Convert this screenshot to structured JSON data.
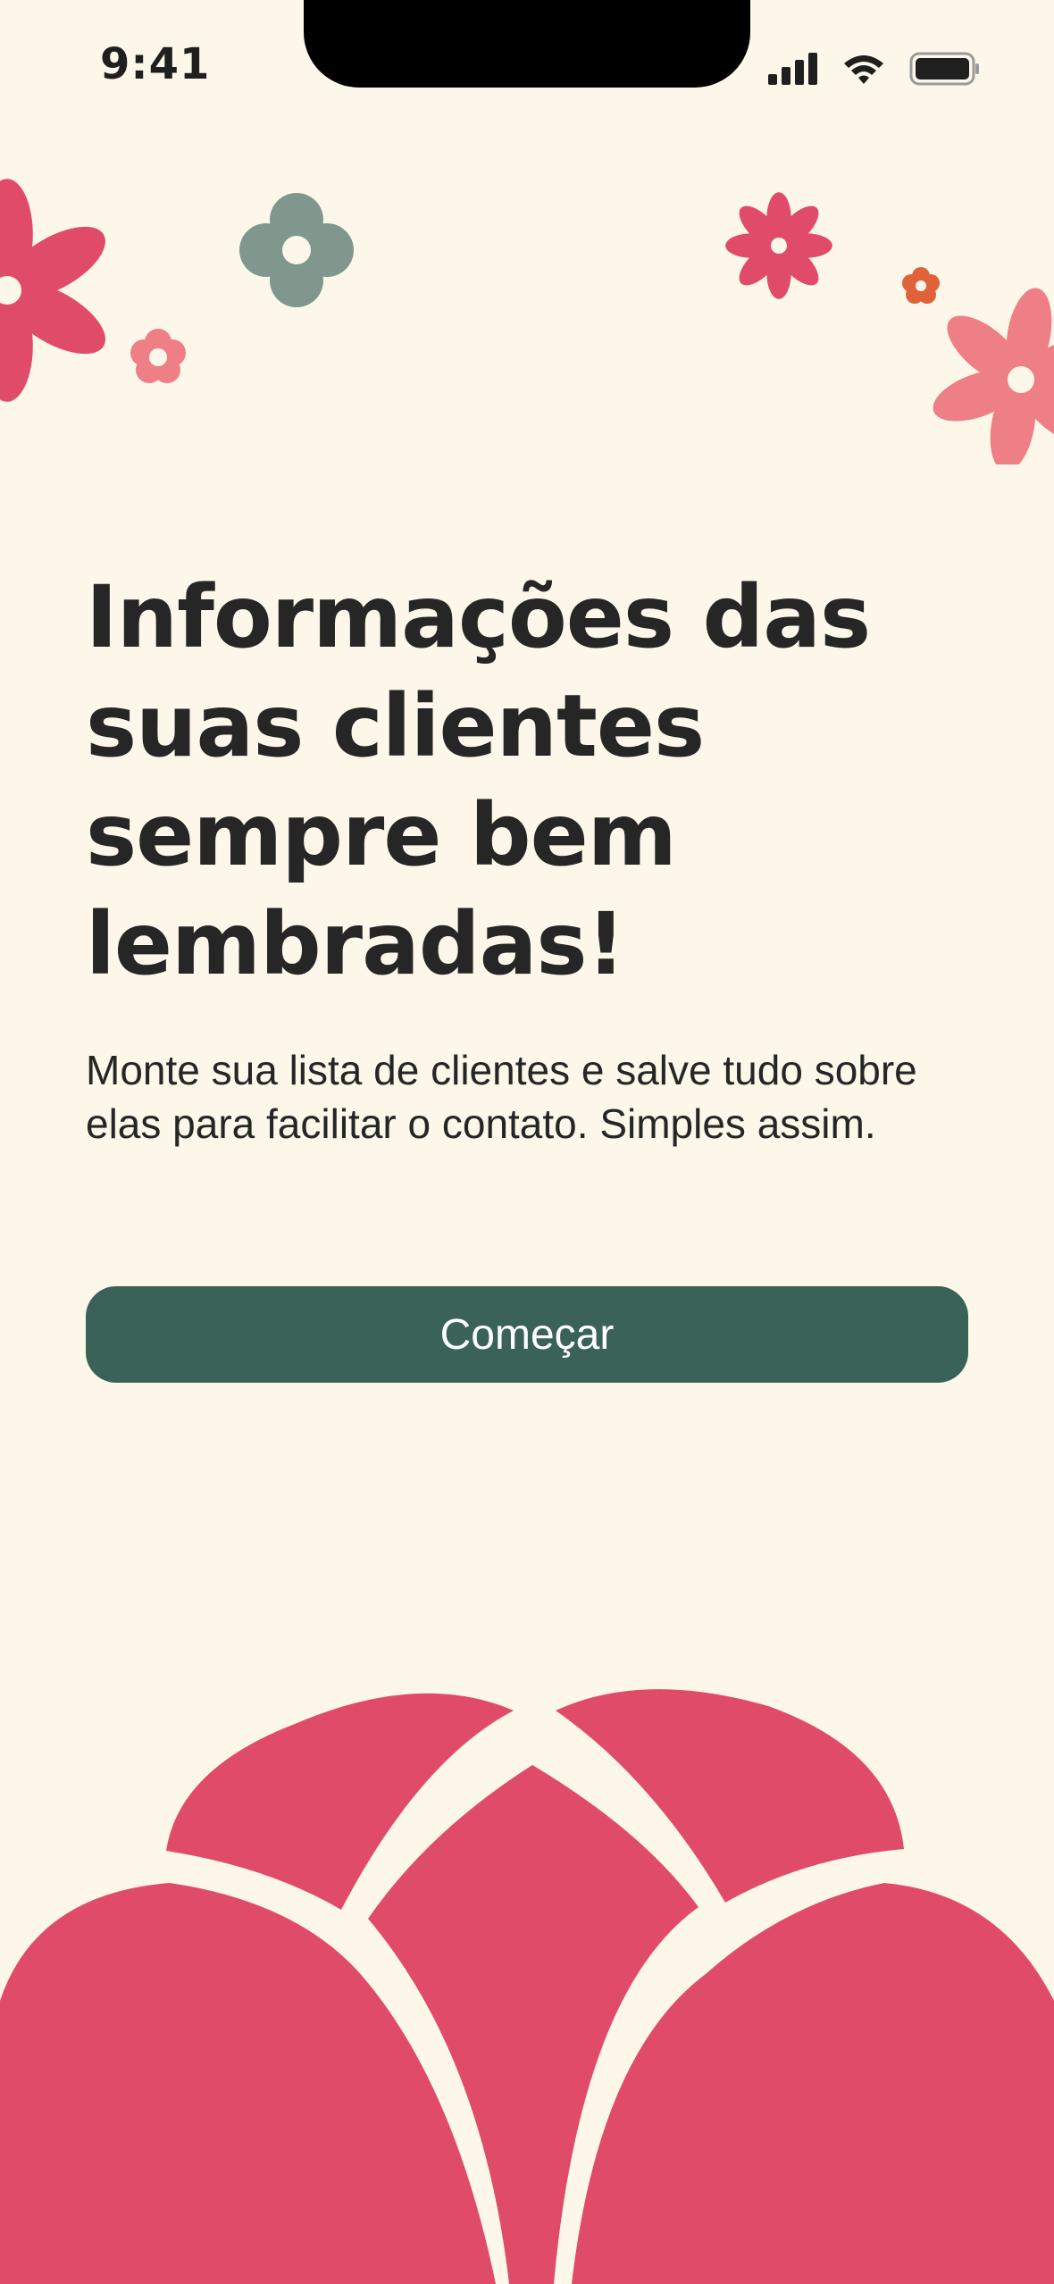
{
  "status_bar": {
    "time": "9:41"
  },
  "onboarding": {
    "headline": "Informações das suas clientes sempre bem lembradas!",
    "subtitle": "Monte sua lista de clientes e salve tudo sobre elas para facilitar o contato. Simples assim.",
    "start_button_label": "Começar"
  },
  "colors": {
    "background": "#FDF7EA",
    "accent_button": "#3A6259",
    "flower_pink": "#E14B6A",
    "flower_light_pink": "#EF7F86",
    "flower_sage": "#7F978C",
    "flower_orange": "#E0623A",
    "text": "#262626"
  },
  "icons": {
    "signal": "cellular-signal-icon",
    "wifi": "wifi-icon",
    "battery": "battery-icon"
  }
}
